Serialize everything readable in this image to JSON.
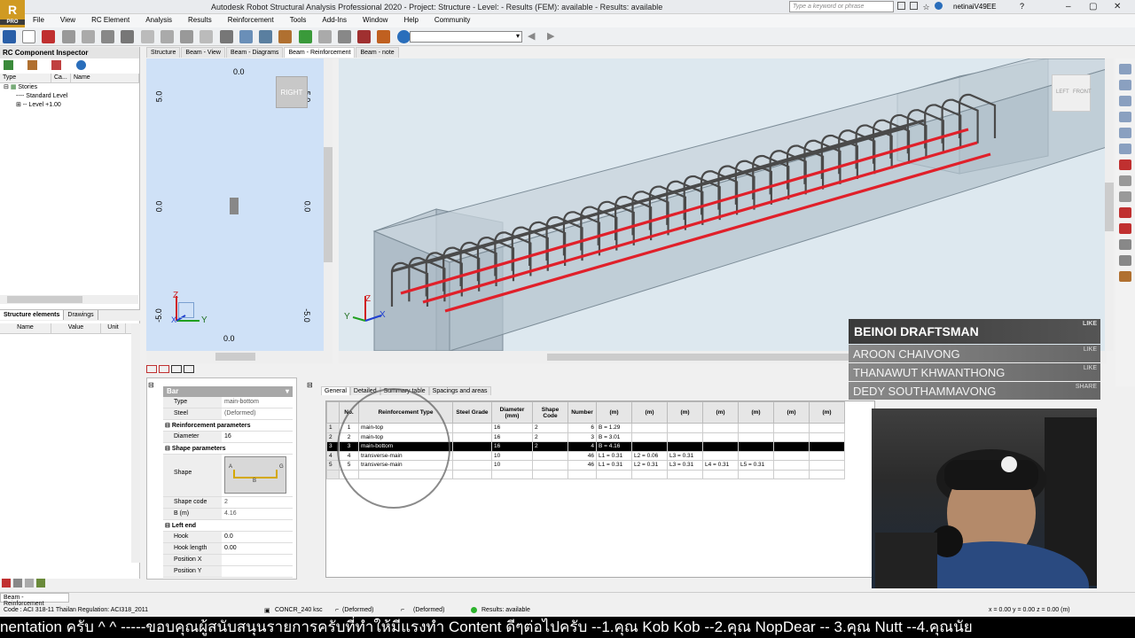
{
  "app": {
    "title": "Autodesk Robot Structural Analysis Professional 2020 - Project: Structure - Level: - Results (FEM): available - Results: available",
    "logo_letter": "R",
    "logo_sub": "PRO",
    "search_placeholder": "Type a keyword or phrase",
    "username": "netinaiV49EE"
  },
  "menu": [
    "File",
    "View",
    "RC Element",
    "Analysis",
    "Results",
    "Reinforcement",
    "Tools",
    "Add-Ins",
    "Window",
    "Help",
    "Community"
  ],
  "inspector": {
    "title": "RC Component Inspector",
    "columns": [
      "Type",
      "Ca...",
      "Name"
    ],
    "tree": [
      "Stories",
      "Standard Level",
      "Level +1.00"
    ],
    "tabs": [
      "Structure elements",
      "Drawings"
    ],
    "prop_columns": [
      "Name",
      "Value",
      "Unit"
    ]
  },
  "doc_tabs": [
    "Structure",
    "Beam - View",
    "Beam - Diagrams",
    "Beam - Reinforcement",
    "Beam - note"
  ],
  "view2d": {
    "ticks_left": [
      "5.0",
      "0.0",
      "-5.0"
    ],
    "ticks_right": [
      "5.0",
      "0.0",
      "-5.0"
    ],
    "top_label": "0.0",
    "bottom_label": "0.0",
    "viewcube": "RIGHT",
    "axes": [
      "Z",
      "Y",
      "X"
    ]
  },
  "view3d": {
    "viewcube": [
      "LEFT",
      "FRONT"
    ],
    "axes": [
      "Z",
      "Y",
      "X"
    ]
  },
  "bar_props": {
    "header": "Bar",
    "rows1": [
      {
        "k": "Type",
        "v": "main-bottom"
      },
      {
        "k": "Steel",
        "v": "(Deformed)"
      }
    ],
    "section_reinf": "Reinforcement parameters",
    "diameter": {
      "k": "Diameter",
      "v": "16"
    },
    "section_shape": "Shape parameters",
    "shape_label": "Shape",
    "shape_letters": [
      "A",
      "B",
      "G"
    ],
    "rows2": [
      {
        "k": "Shape code",
        "v": "2"
      },
      {
        "k": "B (m)",
        "v": "4.16"
      }
    ],
    "section_left": "Left end",
    "rows3": [
      {
        "k": "Hook",
        "v": "0.0"
      },
      {
        "k": "Hook length",
        "v": "0.00"
      },
      {
        "k": "Position X",
        "v": ""
      },
      {
        "k": "Position Y",
        "v": ""
      }
    ]
  },
  "lower_tabs": [
    "General",
    "Detailed",
    "Summary table",
    "Spacings and areas"
  ],
  "rebar_table": {
    "headers": [
      "No.",
      "Reinforcement Type",
      "Steel Grade",
      "Diameter (mm)",
      "Shape Code",
      "Number",
      "(m)",
      "(m)",
      "(m)",
      "(m)",
      "(m)",
      "(m)",
      "(m)"
    ],
    "rows": [
      {
        "idx": "1",
        "no": "1",
        "type": "main-top",
        "grade": "",
        "dia": "16",
        "code": "2",
        "num": "6",
        "l1": "B = 1.29",
        "l2": "",
        "l3": "",
        "l4": "",
        "l5": ""
      },
      {
        "idx": "2",
        "no": "2",
        "type": "main-top",
        "grade": "",
        "dia": "16",
        "code": "2",
        "num": "3",
        "l1": "B = 3.01",
        "l2": "",
        "l3": "",
        "l4": "",
        "l5": ""
      },
      {
        "idx": "3",
        "no": "3",
        "type": "main-bottom",
        "grade": "",
        "dia": "16",
        "code": "2",
        "num": "4",
        "l1": "B = 4.16",
        "l2": "",
        "l3": "",
        "l4": "",
        "l5": ""
      },
      {
        "idx": "4",
        "no": "4",
        "type": "transverse-main",
        "grade": "",
        "dia": "10",
        "code": "",
        "num": "46",
        "l1": "L1 = 0.31",
        "l2": "L2 = 0.06",
        "l3": "L3 = 0.31",
        "l4": "",
        "l5": ""
      },
      {
        "idx": "5",
        "no": "5",
        "type": "transverse-main",
        "grade": "",
        "dia": "10",
        "code": "",
        "num": "46",
        "l1": "L1 = 0.31",
        "l2": "L2 = 0.31",
        "l3": "L3 = 0.31",
        "l4": "L4 = 0.31",
        "l5": "L5 = 0.31"
      }
    ]
  },
  "credits": {
    "main": "BEINOI DRAFTSMAN",
    "main_tag": "LIKE",
    "names": [
      {
        "name": "AROON CHAIVONG",
        "tag": "LIKE"
      },
      {
        "name": "THANAWUT KHWANTHONG",
        "tag": "LIKE"
      },
      {
        "name": "DEDY SOUTHAMMAVONG",
        "tag": "SHARE"
      }
    ]
  },
  "status": {
    "tab": "Beam - Reinforcement",
    "code": "Code : ACI 318-11 Thailan  Regulation: ACI318_2011",
    "concrete": "CONCR_240 ksc",
    "steel1": "(Deformed)",
    "steel2": "(Deformed)",
    "results": "Results: available",
    "coords": "x = 0.00 y = 0.00 z = 0.00   (m)"
  },
  "ticker": "nentation ครับ  ^ ^ -----ขอบคุณผู้สนับสนุนรายการครับที่ทำให้มีแรงทำ Content ดีๆต่อไปครับ --1.คุณ Kob Kob --2.คุณ NopDear -- 3.คุณ Nutt --4.คุณนัย",
  "colors": {
    "rebar_red": "#e0202a",
    "rebar_gray": "#4a4a4a",
    "concrete": "#b9c8d2"
  }
}
